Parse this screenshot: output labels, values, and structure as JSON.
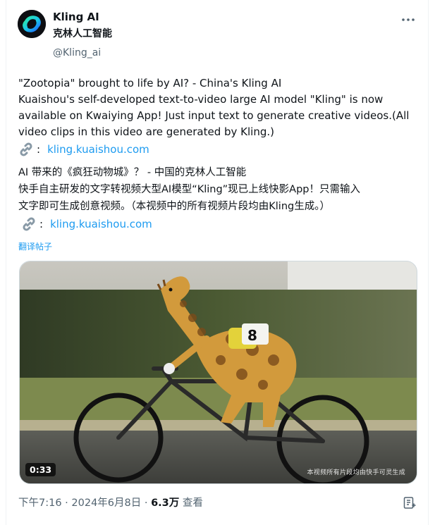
{
  "author": {
    "display_name": "Kling AI",
    "sub_name": "克林人工智能",
    "handle": "@Kling_ai"
  },
  "post": {
    "en_line1": "\"Zootopia\" brought to life by AI? - China's Kling AI",
    "en_line2": "Kuaishou's self-developed text-to-video large AI model \"Kling\" is now",
    "en_line3": "available on Kwaiying App! Just input text to generate creative videos.(All",
    "en_line4": "video clips in this video are generated by Kling.)",
    "link_colon": ":",
    "link_text": "kling.kuaishou.com",
    "zh_line1": "AI 带来的《疯狂动物城》？  - 中国的克林人工智能",
    "zh_line2": "快手自主研发的文字转视频大型AI模型“Kling”现已上线快影App！只需输入",
    "zh_line3": "文字即可生成创意视频。（本视频中的所有视频片段均由Kling生成。）",
    "zh_link_colon": ":",
    "zh_link_text": "kling.kuaishou.com",
    "translate_label": "翻译帖子"
  },
  "media": {
    "duration": "0:33",
    "watermark": "本视频所有片段均由快手可灵生成"
  },
  "meta": {
    "time": "下午7:16 · 2024年6月8日 · ",
    "views_count": "6.3万",
    "views_label": " 查看"
  },
  "icons": {
    "more": "more-horizontal-icon",
    "link": "link-emoji-icon",
    "bookmark": "bookmark-icon"
  },
  "colors": {
    "link": "#1d9bf0",
    "secondary_text": "#536471"
  }
}
